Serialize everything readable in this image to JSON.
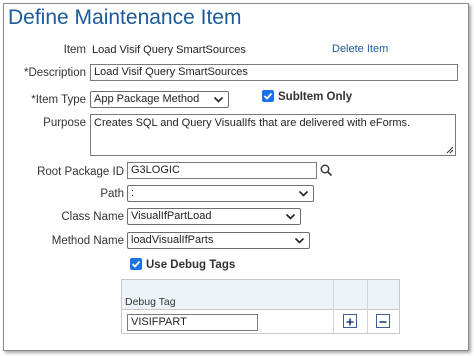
{
  "page": {
    "title": "Define Maintenance Item",
    "delete_link": "Delete Item"
  },
  "item": {
    "label": "Item",
    "value": "Load Visif Query SmartSources"
  },
  "description": {
    "label": "*Description",
    "value": "Load Visif Query SmartSources"
  },
  "item_type": {
    "label": "*Item Type",
    "selected": "App Package Method"
  },
  "subitem_only": {
    "label": "SubItem Only",
    "checked": true
  },
  "purpose": {
    "label": "Purpose",
    "value": "Creates SQL and Query VisualIfs that are delivered with eForms."
  },
  "root_package": {
    "label": "Root Package ID",
    "value": "G3LOGIC"
  },
  "path": {
    "label": "Path",
    "selected": ":"
  },
  "class_name": {
    "label": "Class Name",
    "selected": "VisualIfPartLoad"
  },
  "method_name": {
    "label": "Method Name",
    "selected": "loadVisualIfParts"
  },
  "use_debug_tags": {
    "label": "Use Debug Tags",
    "checked": true
  },
  "debug_grid": {
    "column_header": "Debug Tag",
    "rows": [
      {
        "value": "VISIFPART"
      }
    ]
  },
  "colors": {
    "title": "#1d5a99",
    "checkbox": "#1a73e8",
    "grid_header_bg": "#eef3fa"
  }
}
